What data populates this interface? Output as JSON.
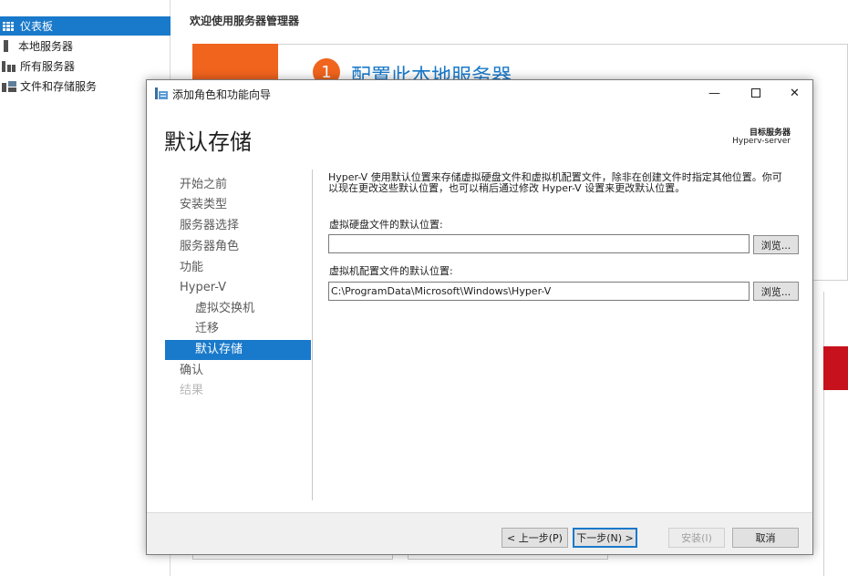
{
  "sidebar": {
    "items": [
      {
        "label": "仪表板",
        "icon": "dashboard-icon",
        "active": true
      },
      {
        "label": "本地服务器",
        "icon": "server-icon"
      },
      {
        "label": "所有服务器",
        "icon": "servers-icon"
      },
      {
        "label": "文件和存储服务",
        "icon": "file-storage-icon"
      }
    ]
  },
  "main": {
    "welcome": "欢迎使用服务器管理器",
    "step_number": "1",
    "step_title": "配置此本地服务器"
  },
  "wizard": {
    "title": "添加角色和功能向导",
    "heading": "默认存储",
    "destination_label": "目标服务器",
    "destination_value": "Hyperv-server",
    "steps": [
      {
        "label": "开始之前",
        "level": 0
      },
      {
        "label": "安装类型",
        "level": 0
      },
      {
        "label": "服务器选择",
        "level": 0
      },
      {
        "label": "服务器角色",
        "level": 0
      },
      {
        "label": "功能",
        "level": 0
      },
      {
        "label": "Hyper-V",
        "level": 0
      },
      {
        "label": "虚拟交换机",
        "level": 1
      },
      {
        "label": "迁移",
        "level": 1
      },
      {
        "label": "默认存储",
        "level": 1,
        "active": true
      },
      {
        "label": "确认",
        "level": 0
      },
      {
        "label": "结果",
        "level": 0,
        "disabled": true
      }
    ],
    "description_line1": "Hyper-V 使用默认位置来存储虚拟硬盘文件和虚拟机配置文件，除非在创建文件时指定其他位置。你可",
    "description_line2": "以现在更改这些默认位置，也可以稍后通过修改 Hyper-V 设置来更改默认位置。",
    "vhd_label": "虚拟硬盘文件的默认位置:",
    "vhd_value": "",
    "vm_label": "虚拟机配置文件的默认位置:",
    "vm_value": "C:\\ProgramData\\Microsoft\\Windows\\Hyper-V",
    "browse_label": "浏览...",
    "buttons": {
      "prev": "< 上一步(P)",
      "next": "下一步(N) >",
      "install": "安装(I)",
      "cancel": "取消"
    },
    "window_controls": {
      "minimize": "—",
      "close": "✕"
    }
  },
  "colors": {
    "accent": "#1979ca",
    "orange": "#f1641d",
    "red": "#c7111d"
  }
}
